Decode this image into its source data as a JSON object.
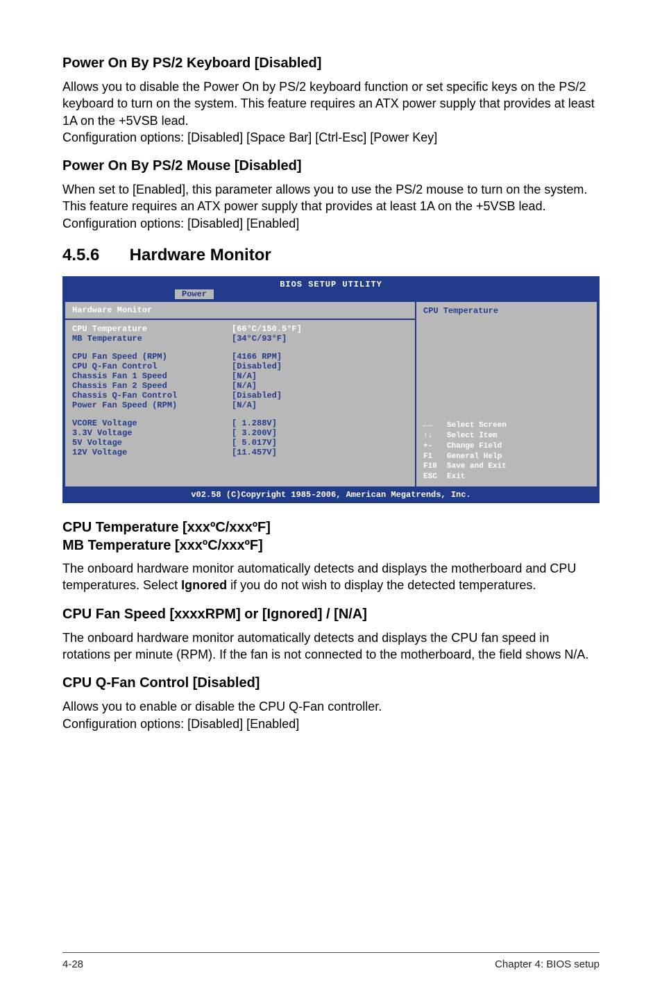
{
  "sec1": {
    "heading": "Power On By PS/2 Keyboard [Disabled]",
    "p": "Allows you to disable the Power On by PS/2 keyboard function or set specific keys on the PS/2 keyboard to turn on the system. This feature requires an ATX power supply that provides at least 1A on the +5VSB lead.\nConfiguration options: [Disabled] [Space Bar] [Ctrl-Esc] [Power Key]"
  },
  "sec2": {
    "heading": "Power On By PS/2 Mouse [Disabled]",
    "p": "When set to [Enabled], this parameter allows you to use the PS/2 mouse to turn on the system. This feature requires an ATX power supply that provides at least 1A on the +5VSB lead. Configuration options: [Disabled] [Enabled]"
  },
  "section_number": "4.5.6",
  "section_title": "Hardware Monitor",
  "bios": {
    "title": "BIOS SETUP UTILITY",
    "tab": "Power",
    "panel_title": "Hardware Monitor",
    "help_title": "CPU Temperature",
    "rows_g1": [
      {
        "lbl": "CPU Temperature",
        "val": "[66°C/150.5°F]",
        "hl": true
      },
      {
        "lbl": "MB Temperature",
        "val": "[34°C/93°F]"
      }
    ],
    "rows_g2": [
      {
        "lbl": "CPU Fan Speed (RPM)",
        "val": "[4166 RPM]"
      },
      {
        "lbl": "CPU Q-Fan Control",
        "val": "[Disabled]"
      },
      {
        "lbl": "Chassis Fan 1 Speed",
        "val": "[N/A]"
      },
      {
        "lbl": "Chassis Fan 2 Speed",
        "val": "[N/A]"
      },
      {
        "lbl": "Chassis Q-Fan Control",
        "val": "[Disabled]"
      },
      {
        "lbl": "Power Fan Speed (RPM)",
        "val": "[N/A]"
      }
    ],
    "rows_g3": [
      {
        "lbl": "VCORE Voltage",
        "val": "[ 1.288V]"
      },
      {
        "lbl": "3.3V Voltage",
        "val": "[ 3.200V]"
      },
      {
        "lbl": "5V Voltage",
        "val": "[ 5.017V]"
      },
      {
        "lbl": "12V Voltage",
        "val": "[11.457V]"
      }
    ],
    "nav": [
      {
        "k": "←→",
        "d": "Select Screen"
      },
      {
        "k": "↑↓",
        "d": "Select Item"
      },
      {
        "k": "+-",
        "d": "Change Field"
      },
      {
        "k": "F1",
        "d": "General Help"
      },
      {
        "k": "F10",
        "d": "Save and Exit"
      },
      {
        "k": "ESC",
        "d": "Exit"
      }
    ],
    "footer": "v02.58 (C)Copyright 1985-2006, American Megatrends, Inc."
  },
  "sec3": {
    "h1": "CPU Temperature [xxxºC/xxxºF]",
    "h2": "MB Temperature [xxxºC/xxxºF]",
    "p_pre": "The onboard hardware monitor automatically detects and displays the motherboard and CPU temperatures. Select ",
    "p_bold": "Ignored",
    "p_post": " if you do not wish to display the detected temperatures."
  },
  "sec4": {
    "heading": "CPU Fan Speed [xxxxRPM] or [Ignored] / [N/A]",
    "p": "The onboard hardware monitor automatically detects and displays the CPU fan speed in rotations per minute (RPM). If the fan is not connected to the motherboard, the field shows N/A."
  },
  "sec5": {
    "heading": "CPU Q-Fan Control [Disabled]",
    "p": "Allows you to enable or disable the CPU Q-Fan controller.\nConfiguration options: [Disabled] [Enabled]"
  },
  "footer": {
    "left": "4-28",
    "right": "Chapter 4: BIOS setup"
  }
}
